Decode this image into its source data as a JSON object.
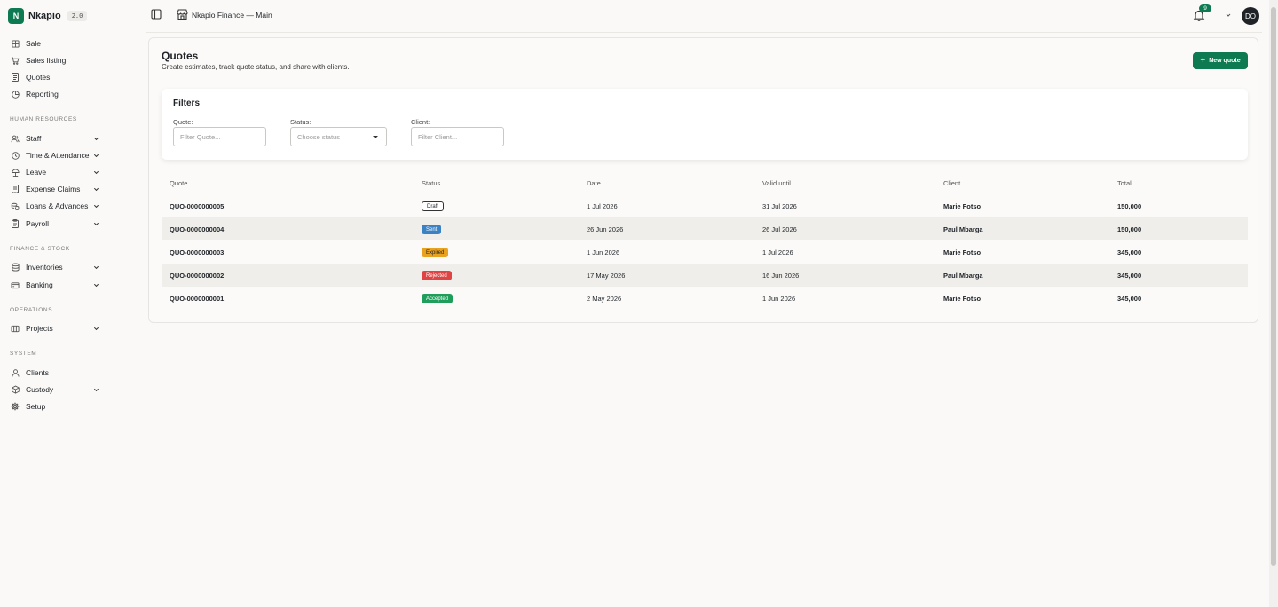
{
  "brand": {
    "logo_letter": "N",
    "name": "Nkapio",
    "version": "2.0"
  },
  "sidebar": {
    "top_items": [
      {
        "label": "Sale",
        "icon": "grid-icon"
      },
      {
        "label": "Sales listing",
        "icon": "cart-icon"
      },
      {
        "label": "Quotes",
        "icon": "document-icon"
      },
      {
        "label": "Reporting",
        "icon": "pie-icon"
      }
    ],
    "sections": [
      {
        "label": "HUMAN RESOURCES",
        "items": [
          {
            "label": "Staff",
            "icon": "users-icon",
            "expandable": true
          },
          {
            "label": "Time & Attendance",
            "icon": "clock-icon",
            "expandable": true
          },
          {
            "label": "Leave",
            "icon": "beach-icon",
            "expandable": true
          },
          {
            "label": "Expense Claims",
            "icon": "receipt-icon",
            "expandable": true
          },
          {
            "label": "Loans & Advances",
            "icon": "coins-icon",
            "expandable": true
          },
          {
            "label": "Payroll",
            "icon": "clipboard-icon",
            "expandable": true
          }
        ]
      },
      {
        "label": "FINANCE & STOCK",
        "items": [
          {
            "label": "Inventories",
            "icon": "database-icon",
            "expandable": true
          },
          {
            "label": "Banking",
            "icon": "bank-icon",
            "expandable": true
          }
        ]
      },
      {
        "label": "OPERATIONS",
        "items": [
          {
            "label": "Projects",
            "icon": "columns-icon",
            "expandable": true
          }
        ]
      },
      {
        "label": "SYSTEM",
        "items": [
          {
            "label": "Clients",
            "icon": "user-icon",
            "expandable": false
          },
          {
            "label": "Custody",
            "icon": "box-icon",
            "expandable": true
          },
          {
            "label": "Setup",
            "icon": "gear-icon",
            "expandable": false
          }
        ]
      }
    ]
  },
  "topbar": {
    "workspace": "Nkapio Finance — Main",
    "notifications_count": "9",
    "avatar_initials": "DO"
  },
  "page": {
    "title": "Quotes",
    "subtitle": "Create estimates, track quote status, and share with clients.",
    "new_button": "New quote"
  },
  "filters": {
    "title": "Filters",
    "quote_label": "Quote:",
    "quote_placeholder": "Filter Quote...",
    "status_label": "Status:",
    "status_placeholder": "Choose status",
    "client_label": "Client:",
    "client_placeholder": "Filter Client..."
  },
  "table": {
    "headers": [
      "Quote",
      "Status",
      "Date",
      "Valid until",
      "Client",
      "Total"
    ],
    "rows": [
      {
        "quote": "QUO-0000000005",
        "status": "Draft",
        "date": "1 Jul 2026",
        "valid_until": "31 Jul 2026",
        "client": "Marie Fotso",
        "total": "150,000"
      },
      {
        "quote": "QUO-0000000004",
        "status": "Sent",
        "date": "26 Jun 2026",
        "valid_until": "26 Jul 2026",
        "client": "Paul Mbarga",
        "total": "150,000"
      },
      {
        "quote": "QUO-0000000003",
        "status": "Expired",
        "date": "1 Jun 2026",
        "valid_until": "1 Jul 2026",
        "client": "Marie Fotso",
        "total": "345,000"
      },
      {
        "quote": "QUO-0000000002",
        "status": "Rejected",
        "date": "17 May 2026",
        "valid_until": "16 Jun 2026",
        "client": "Paul Mbarga",
        "total": "345,000"
      },
      {
        "quote": "QUO-0000000001",
        "status": "Accepted",
        "date": "2 May 2026",
        "valid_until": "1 Jun 2026",
        "client": "Marie Fotso",
        "total": "345,000"
      }
    ]
  },
  "colors": {
    "brand": "#0e7a52",
    "status_draft": "#ffffff",
    "status_sent": "#3b82c4",
    "status_expired": "#e9a21f",
    "status_rejected": "#e04343",
    "status_accepted": "#1e9e5a"
  }
}
